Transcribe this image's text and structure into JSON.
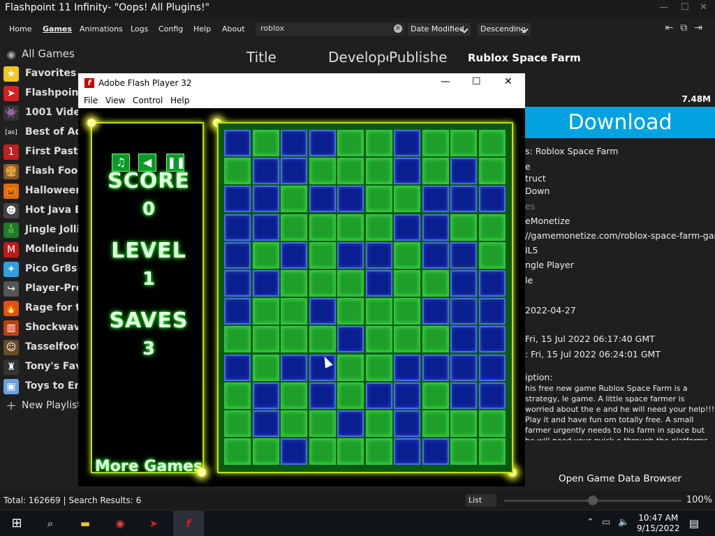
{
  "window": {
    "title": "Flashpoint 11 Infinity- \"Oops! All Plugins!\"",
    "controls": [
      "—",
      "☐",
      "✕"
    ]
  },
  "menu": {
    "items": [
      "Home",
      "Games",
      "Animations",
      "Logs",
      "Config",
      "Help",
      "About"
    ],
    "active": "Games"
  },
  "search": {
    "value": "roblox"
  },
  "sort": {
    "by": "Date Modified",
    "order": "Descending"
  },
  "sidebar": {
    "all_games": "All Games",
    "items": [
      {
        "label": "Favorites",
        "sub": "by You!",
        "icon": "star-icon",
        "glyph": "★",
        "color": "#f3c623"
      },
      {
        "label": "Flashpoint th",
        "sub": "",
        "icon": "flashpoint-icon",
        "glyph": "➤",
        "color": "#d42020"
      },
      {
        "label": "1001 Video",
        "sub": "",
        "icon": "invader-icon",
        "glyph": "👾",
        "color": "#333"
      },
      {
        "label": "Best of Adu",
        "sub": "",
        "icon": "as-icon",
        "glyph": "[as]",
        "color": "#222"
      },
      {
        "label": "First Past th",
        "sub": "",
        "icon": "one-icon",
        "glyph": "1",
        "color": "#c02020"
      },
      {
        "label": "Flash Food",
        "sub": "",
        "icon": "burger-icon",
        "glyph": "🍔",
        "color": "#8a5a2a"
      },
      {
        "label": "Halloween",
        "sub": "",
        "icon": "pumpkin-icon",
        "glyph": "🎃",
        "color": "#e06a10"
      },
      {
        "label": "Hot Java Be",
        "sub": "",
        "icon": "face-icon",
        "glyph": "☻",
        "color": "#444"
      },
      {
        "label": "Jingle Jollie",
        "sub": "",
        "icon": "tree-icon",
        "glyph": "🎄",
        "color": "#1f7a2a"
      },
      {
        "label": "Molleindust",
        "sub": "",
        "icon": "mi-icon",
        "glyph": "M",
        "color": "#c01818"
      },
      {
        "label": "Pico Gr8s",
        "sub": "by",
        "icon": "pico-icon",
        "glyph": "✦",
        "color": "#30a0e0"
      },
      {
        "label": "Player-Prod",
        "sub": "",
        "icon": "share-icon",
        "glyph": "↪",
        "color": "#555"
      },
      {
        "label": "Rage for the",
        "sub": "",
        "icon": "flame-icon",
        "glyph": "🔥",
        "color": "#e05010"
      },
      {
        "label": "Shockwave",
        "sub": "",
        "icon": "shockwave-icon",
        "glyph": "▥",
        "color": "#c04010"
      },
      {
        "label": "Tasselfoot's",
        "sub": "",
        "icon": "tasselfoot-icon",
        "glyph": "☺",
        "color": "#6a4a2a"
      },
      {
        "label": "Tony's Favo",
        "sub": "",
        "icon": "figure-icon",
        "glyph": "♜",
        "color": "#333"
      },
      {
        "label": "Toys to Enjo",
        "sub": "",
        "icon": "toys-icon",
        "glyph": "▣",
        "color": "#6aa0e0"
      }
    ],
    "new_playlist": "New Playlist"
  },
  "columns": [
    "Title",
    "Develope",
    "Publisher"
  ],
  "detail": {
    "title": "Rublox Space Farm",
    "filesize": "7.48M",
    "download": "Download",
    "lines": [
      {
        "text": "s: Roblox Space Farm",
        "dim": false
      },
      {
        "text": "e",
        "dim": false
      },
      {
        "text": "truct",
        "dim": false
      },
      {
        "text": "Down",
        "dim": false
      },
      {
        "text": "es",
        "dim": true
      },
      {
        "text": "eMonetize",
        "dim": false
      },
      {
        "text": "//gamemonetize.com/roblox-space-farm-game",
        "dim": false
      },
      {
        "text": "IL5",
        "dim": false
      },
      {
        "text": "ngle Player",
        "dim": false
      },
      {
        "text": "le",
        "dim": false
      },
      {
        "text": "2022-04-27",
        "dim": false
      },
      {
        "text": "Fri, 15 Jul 2022 06:17:40 GMT",
        "dim": false
      },
      {
        "text": ":  Fri, 15 Jul 2022 06:24:01 GMT",
        "dim": false
      },
      {
        "text": "iption:",
        "dim": false
      }
    ],
    "description": "his free new game Rublox Space Farm is a strategy, le game. A little space farmer is worried about the e and he will need your help!!! Play it and have fun om totally free. A small farmer urgently needs to his farm in space but he will need your quick e through the platforms of this planet without falling",
    "open_data": "Open Game Data Browser"
  },
  "status": {
    "text": "Total: 162669 | Search Results: 6",
    "view": "List",
    "zoom": "100%"
  },
  "flash": {
    "title": "Adobe Flash Player 32",
    "menu": [
      "File",
      "View",
      "Control",
      "Help"
    ]
  },
  "game": {
    "score_label": "SCORE",
    "score": "0",
    "level_label": "LEVEL",
    "level": "1",
    "saves_label": "SAVES",
    "saves": "3",
    "more_games": "More Games",
    "grid": [
      "bgbbggbggg",
      "gbbgggbgbg",
      "bbgbbggbbb",
      "bbggggbbgg",
      "bgbgbbgbbg",
      "bbgggbggbb",
      "bggbgggbbb",
      "ggggbgggbb",
      "bgbbggbbbb",
      "gbgbgbbgbb",
      "gbggbgbggg",
      "ggbgggbbgg"
    ]
  },
  "taskbar": {
    "time": "10:47 AM",
    "date": "9/15/2022",
    "notifications": "1"
  }
}
